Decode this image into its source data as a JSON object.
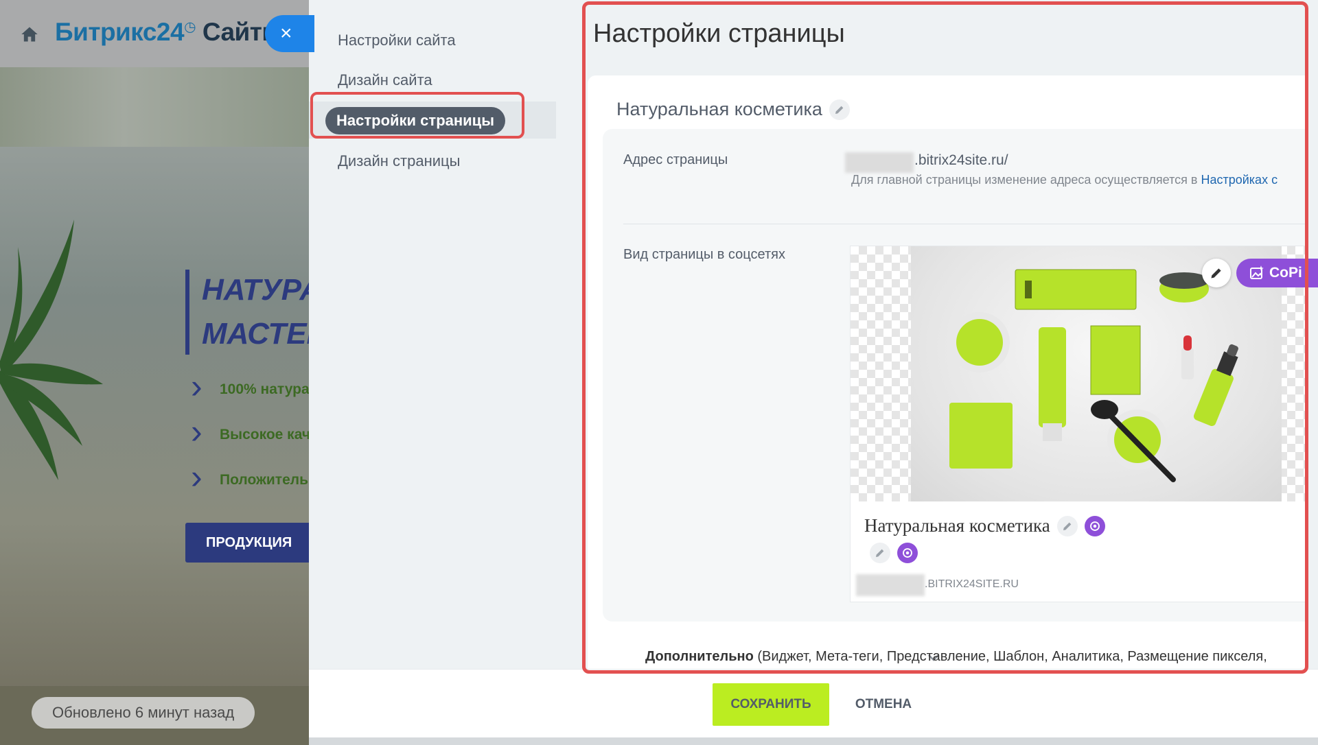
{
  "background": {
    "logo_text_1": "Битрикс24",
    "logo_text_2": "Сайты",
    "headline_1": "НАТУРАЛ",
    "headline_2": "МАСТЕР",
    "bullets": [
      "100% натура",
      "Высокое кач",
      "Положитель"
    ],
    "products_button": "ПРОДУКЦИЯ",
    "updated_text": "Обновлено 6 минут назад"
  },
  "close_button": "×",
  "menu": {
    "items": [
      {
        "label": "Настройки сайта"
      },
      {
        "label": "Дизайн сайта"
      },
      {
        "label": "Настройки страницы"
      },
      {
        "label": "Дизайн страницы"
      }
    ],
    "active_index": 2
  },
  "page": {
    "title": "Настройки страницы",
    "card_title": "Натуральная косметика",
    "address": {
      "label": "Адрес страницы",
      "value": ".bitrix24site.ru/",
      "hint_text": "Для главной страницы изменение адреса осуществляется в ",
      "hint_link": "Настройках с"
    },
    "social": {
      "label": "Вид страницы в соцсетях",
      "copilot_label": "CoPi",
      "title": "Натуральная косметика",
      "url": ".BITRIX24SITE.RU"
    },
    "more": {
      "label": "Дополнительно",
      "items": "(Виджет,  Мета-теги,  Представление,  Шаблон,  Аналитика,  Размещение пикселя,"
    }
  },
  "footer": {
    "save_label": "СОХРАНИТЬ",
    "cancel_label": "ОТМЕНА"
  },
  "colors": {
    "accent_green": "#bbed21",
    "copilot_purple": "#8e4fd9",
    "highlight_red": "#e25050",
    "close_blue": "#1e84e8"
  }
}
